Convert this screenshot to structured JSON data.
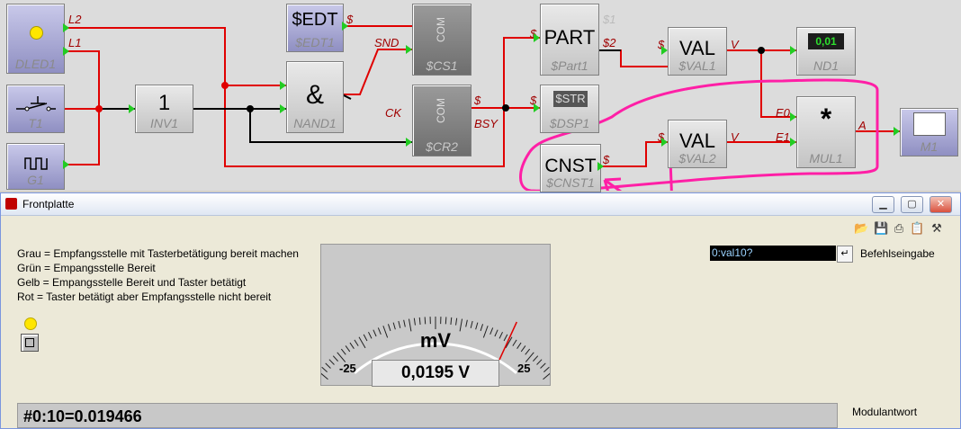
{
  "modules": {
    "dled1": {
      "name": "DLED1",
      "ports": [
        "L2",
        "L1"
      ]
    },
    "t1": {
      "name": "T1"
    },
    "g1": {
      "name": "G1"
    },
    "inv1": {
      "symbol": "1",
      "name": "INV1"
    },
    "edt": {
      "symbol": "$EDT",
      "name": "$EDT1",
      "port": "$"
    },
    "nand1": {
      "symbol": "&",
      "name": "NAND1"
    },
    "cs1": {
      "vertical": "COM",
      "name": "$CS1",
      "port_in": "SND"
    },
    "cr2": {
      "vertical": "COM",
      "name": "$CR2",
      "port_in": "CK",
      "port_out": "$",
      "port_busy": "BSY"
    },
    "part": {
      "symbol": "PART",
      "name": "$Part1",
      "port_in": "$",
      "out1": "$1",
      "out2": "$2"
    },
    "dsp": {
      "symbol": "$STR",
      "name": "$DSP1",
      "port_in": "$"
    },
    "val1": {
      "symbol": "VAL",
      "name": "$VAL1",
      "port_in": "$",
      "port_out": "V"
    },
    "nd1": {
      "display": "0,01",
      "name": "ND1"
    },
    "val2": {
      "symbol": "VAL",
      "name": "$VAL2",
      "port_in": "$",
      "port_out": "V"
    },
    "mul1": {
      "symbol": "*",
      "name": "MUL1",
      "in1": "E0",
      "in2": "E1",
      "out": "A"
    },
    "m1": {
      "name": "M1"
    },
    "cnst": {
      "symbol": "CNST",
      "name": "$CNST1",
      "port_out": "$"
    }
  },
  "frontpanel": {
    "title": "Frontplatte",
    "legend": [
      "Grau = Empfangsstelle mit Tasterbetätigung bereit machen",
      "Grün = Empangsstelle Bereit",
      "Gelb = Empangsstelle Bereit und Taster betätigt",
      "Rot   = Taster betätigt aber Empfangsstelle nicht bereit"
    ],
    "meter": {
      "unit": "mV",
      "min_label": "-25",
      "max_label": "25",
      "readout": "0,0195  V",
      "value": 0.0195,
      "min": -25,
      "max": 25
    },
    "command_value": "0:val10?",
    "command_label": "Befehlseingabe",
    "response": "#0:10=0.019466",
    "response_label": "Modulantwort"
  },
  "colors": {
    "wire": "#e00000",
    "wire_black": "#000000",
    "port": "#22cc22",
    "annotation": "#ff1fa6",
    "led": "#ffe600"
  }
}
